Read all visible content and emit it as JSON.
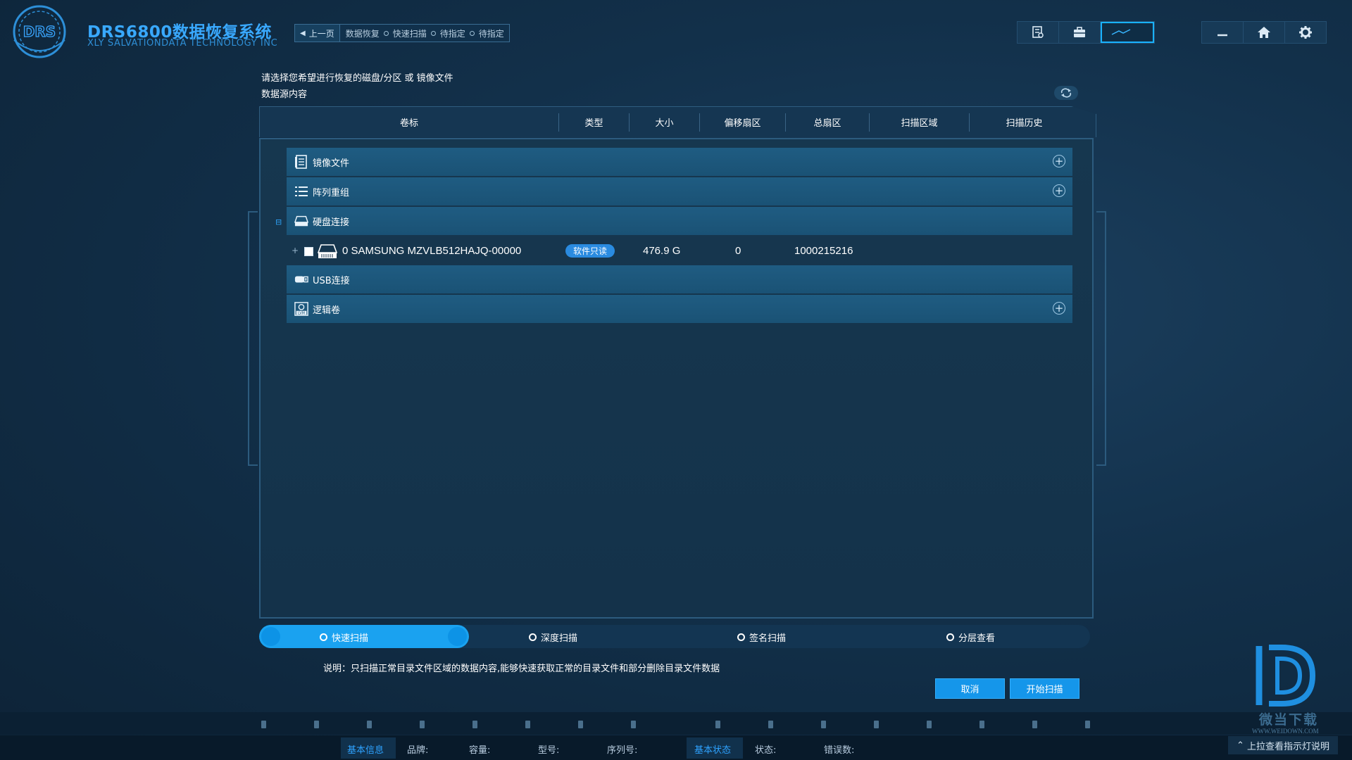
{
  "app": {
    "logo_text": "DRS",
    "title": "DRS6800数据恢复系统",
    "subtitle": "XLY SALVATIONDATA TECHNOLOGY INC"
  },
  "breadcrumb": {
    "back_label": "上一页",
    "steps": [
      "数据恢复",
      "快速扫描",
      "待指定",
      "待指定"
    ]
  },
  "toolbar": {
    "left_icons": [
      "report-icon",
      "briefcase-icon",
      "monitor-icon"
    ],
    "right_icons": [
      "minimize-icon",
      "home-icon",
      "gear-icon"
    ]
  },
  "prompt": {
    "line1": "请选择您希望进行恢复的磁盘/分区 或 镜像文件",
    "line2": "数据源内容"
  },
  "table": {
    "columns": [
      "卷标",
      "类型",
      "大小",
      "偏移扇区",
      "总扇区",
      "扫描区域",
      "扫描历史"
    ],
    "groups": [
      {
        "label": "镜像文件",
        "icon": "document-icon",
        "addable": true
      },
      {
        "label": "阵列重组",
        "icon": "list-icon",
        "addable": true
      },
      {
        "label": "硬盘连接",
        "icon": "harddisk-icon",
        "addable": false
      },
      {
        "label": "USB连接",
        "icon": "usb-icon",
        "addable": false
      },
      {
        "label": "逻辑卷",
        "icon": "lvm-icon",
        "addable": true
      }
    ],
    "disk_row": {
      "expander": "+",
      "name": "0  SAMSUNG MZVLB512HAJQ-00000",
      "badge": "软件只读",
      "size": "476.9 G",
      "offset": "0",
      "total": "1000215216"
    },
    "collapse_marker": "⊟"
  },
  "scan_modes": {
    "options": [
      "快速扫描",
      "深度扫描",
      "签名扫描",
      "分层查看"
    ],
    "selected": "快速扫描"
  },
  "description": "说明：只扫描正常目录文件区域的数据内容,能够快速获取正常的目录文件和部分删除目录文件数据",
  "actions": {
    "cancel": "取消",
    "start": "开始扫描"
  },
  "status_bar": {
    "basic_info": "基本信息",
    "brand": "品牌:",
    "capacity": "容量:",
    "model": "型号:",
    "serial": "序列号:",
    "basic_state": "基本状态",
    "state": "状态:",
    "errors": "错误数:",
    "pullup": "上拉查看指示灯说明"
  },
  "watermark": {
    "text": "微当下载",
    "url": "WWW.WEIDOWN.COM"
  },
  "colors": {
    "accent": "#1aa2f0",
    "background": "#12304a",
    "group_row": "#1f5c82",
    "badge": "#2a8be0"
  }
}
